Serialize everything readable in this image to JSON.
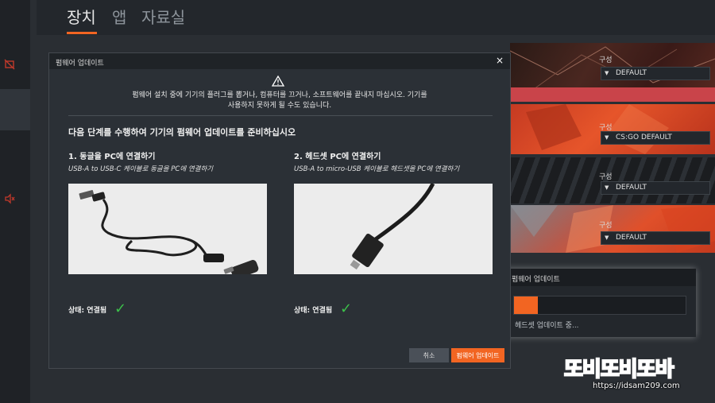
{
  "header": {
    "tabs": [
      {
        "label": "장치",
        "active": true
      },
      {
        "label": "앱",
        "active": false
      },
      {
        "label": "자료실",
        "active": false
      }
    ]
  },
  "rail": {
    "icons": [
      "mic-muted-icon",
      "speaker-muted-icon"
    ]
  },
  "devices": [
    {
      "config_label": "구성",
      "config_value": "DEFAULT",
      "highlight": false
    },
    {
      "config_label": "구성",
      "config_value": "CS:GO DEFAULT",
      "highlight": true
    },
    {
      "config_label": "구성",
      "config_value": "DEFAULT",
      "highlight": false
    },
    {
      "config_label": "구성",
      "config_value": "DEFAULT",
      "highlight": false
    }
  ],
  "toast": {
    "title": "펌웨어 업데이트",
    "status": "헤드셋 업데이트 중...",
    "progress": 0.14
  },
  "modal": {
    "title": "펌웨어 업데이트",
    "close": "×",
    "warning_line1": "펌웨어 설치 중에 기기의 플러그를 뽑거나, 컴퓨터를 끄거나, 소프트웨어를 끝내지 마십시오. 기기를",
    "warning_line2": "사용하지 못하게 될 수도 있습니다.",
    "prep_title": "다음 단계를 수행하여 기기의 펌웨어 업데이트를 준비하십시오",
    "steps": [
      {
        "title": "1. 동글을 PC에 연결하기",
        "subtitle": "USB-A to USB-C 케이블로 동글을 PC에 연결하기",
        "status": "상태: 연결됨"
      },
      {
        "title": "2. 헤드셋 PC에 연결하기",
        "subtitle": "USB-A to micro-USB 케이블로 헤드셋을 PC에 연결하기",
        "status": "상태: 연결됨"
      }
    ],
    "cancel_label": "취소",
    "update_label": "펌웨어 업데이트"
  },
  "watermark": {
    "logo_text": "또비또비또바",
    "url": "https://idsam209.com"
  },
  "colors": {
    "accent": "#f26522",
    "success": "#3cbf4a",
    "panel": "#2b3036"
  }
}
